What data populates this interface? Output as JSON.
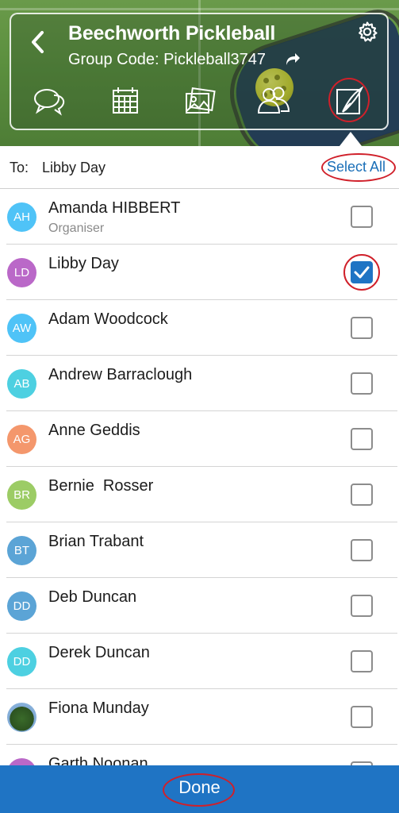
{
  "header": {
    "title": "Beechworth Pickleball",
    "group_code": "Group Code: Pickleball3747",
    "tabs": [
      {
        "icon": "chat-icon"
      },
      {
        "icon": "calendar-icon"
      },
      {
        "icon": "photos-icon"
      },
      {
        "icon": "members-icon"
      },
      {
        "icon": "compose-icon",
        "active": true
      }
    ]
  },
  "recipients": {
    "to_label": "To:",
    "to_value": "Libby Day",
    "select_all": "Select All"
  },
  "members": [
    {
      "initials": "AH",
      "name": "Amanda HIBBERT",
      "role": "Organiser",
      "color": "#4fc3f7",
      "checked": false
    },
    {
      "initials": "LD",
      "name": "Libby Day",
      "role": "",
      "color": "#ba68c8",
      "checked": true
    },
    {
      "initials": "AW",
      "name": "Adam Woodcock",
      "role": "",
      "color": "#4fc3f7",
      "checked": false
    },
    {
      "initials": "AB",
      "name": "Andrew Barraclough",
      "role": "",
      "color": "#4dd0e1",
      "checked": false
    },
    {
      "initials": "AG",
      "name": "Anne Geddis",
      "role": "",
      "color": "#f4976c",
      "checked": false
    },
    {
      "initials": "BR",
      "name": "Bernie  Rosser",
      "role": "",
      "color": "#9ccc65",
      "checked": false
    },
    {
      "initials": "BT",
      "name": "Brian Trabant",
      "role": "",
      "color": "#5ba4d6",
      "checked": false
    },
    {
      "initials": "DD",
      "name": "Deb Duncan",
      "role": "",
      "color": "#5ba4d6",
      "checked": false
    },
    {
      "initials": "DD",
      "name": "Derek Duncan",
      "role": "",
      "color": "#4dd0e1",
      "checked": false
    },
    {
      "initials": "",
      "name": "Fiona Munday",
      "role": "",
      "color": "#4a7a3a",
      "checked": false,
      "photo": true
    },
    {
      "initials": "",
      "name": "Garth Noonan",
      "role": "",
      "color": "#ba68c8",
      "checked": false
    }
  ],
  "footer": {
    "done_label": "Done"
  }
}
